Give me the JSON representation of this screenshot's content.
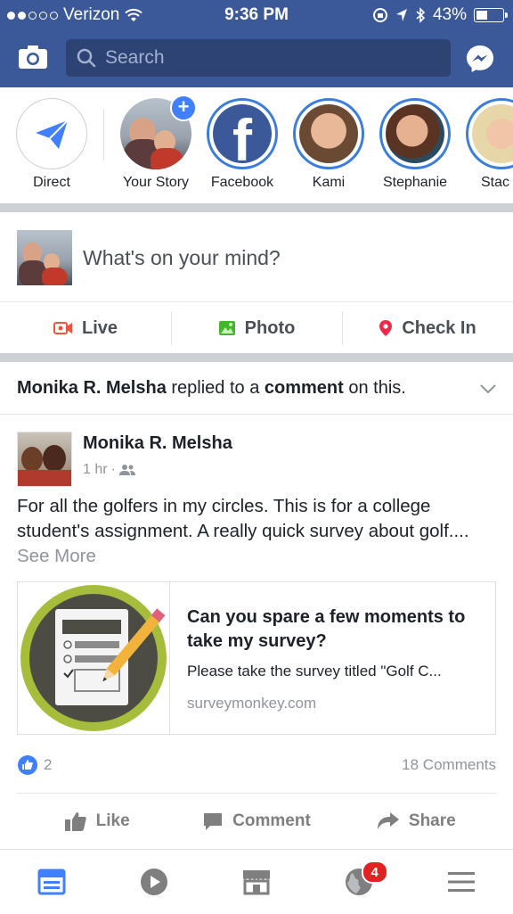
{
  "status_bar": {
    "carrier": "Verizon",
    "time": "9:36 PM",
    "battery": "43%"
  },
  "search": {
    "placeholder": "Search"
  },
  "stories": [
    {
      "label": "Direct"
    },
    {
      "label": "Your Story"
    },
    {
      "label": "Facebook"
    },
    {
      "label": "Kami"
    },
    {
      "label": "Stephanie"
    },
    {
      "label": "Stac"
    }
  ],
  "composer": {
    "prompt": "What's on your mind?"
  },
  "composer_actions": {
    "live": "Live",
    "photo": "Photo",
    "checkin": "Check In"
  },
  "notification": {
    "actor": "Monika R. Melsha",
    "middle": " replied to a ",
    "object": "comment",
    "tail": " on this."
  },
  "post": {
    "author": "Monika R. Melsha",
    "time": "1 hr",
    "separator": "·",
    "text": "For all the golfers in my circles. This is for a college student's assignment. A really quick survey about golf....",
    "see_more": "See More",
    "link": {
      "title": "Can you spare a few moments to take my survey?",
      "description": "Please take the survey titled \"Golf C...",
      "domain": "surveymonkey.com"
    },
    "likes": "2",
    "comments": "18 Comments",
    "actions": {
      "like": "Like",
      "comment": "Comment",
      "share": "Share"
    }
  },
  "bottom_nav": {
    "notifications_badge": "4"
  },
  "colors": {
    "brand": "#3b5998",
    "accent": "#4080ff",
    "live": "#f5533d",
    "photo": "#42b72a",
    "checkin": "#f02849"
  }
}
